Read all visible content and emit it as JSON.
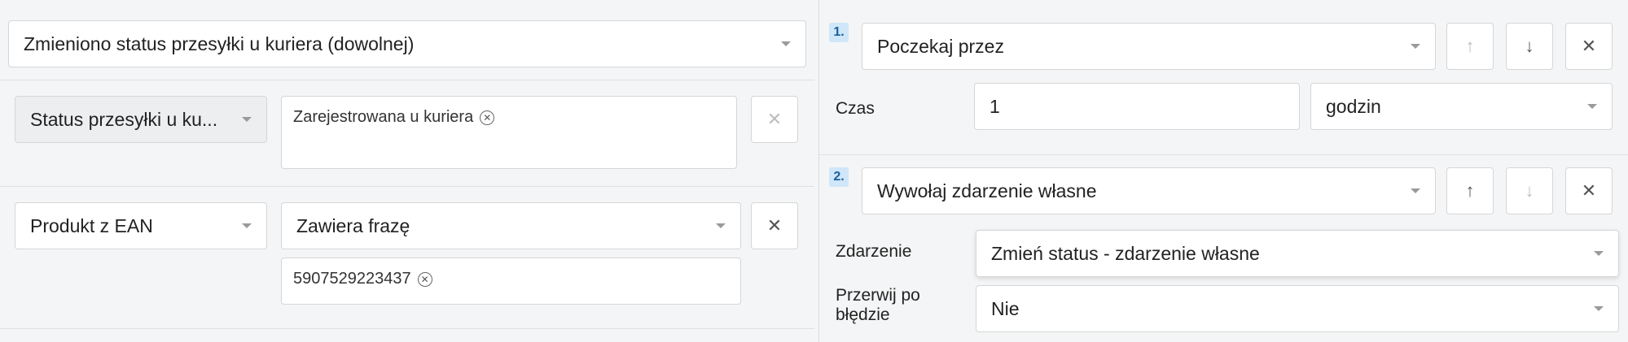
{
  "left": {
    "trigger": {
      "value": "Zmieniono status przesyłki u kuriera (dowolnej)"
    },
    "condition1": {
      "field": "Status przesyłki u ku...",
      "tag": "Zarejestrowana u kuriera"
    },
    "condition2": {
      "field": "Produkt z EAN",
      "operator": "Zawiera frazę",
      "tag": "5907529223437"
    }
  },
  "right": {
    "step1": {
      "number": "1.",
      "action": "Poczekaj przez",
      "time_label": "Czas",
      "time_value": "1",
      "unit": "godzin"
    },
    "step2": {
      "number": "2.",
      "action": "Wywołaj zdarzenie własne",
      "event_label": "Zdarzenie",
      "event_value": "Zmień status - zdarzenie własne",
      "stop_label_line1": "Przerwij po",
      "stop_label_line2": "błędzie",
      "stop_value": "Nie"
    }
  },
  "icons": {
    "up": "↑",
    "down": "↓",
    "close": "✕"
  }
}
